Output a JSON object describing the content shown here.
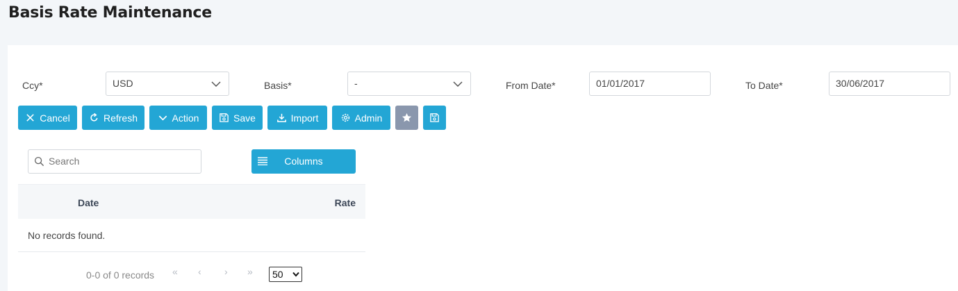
{
  "page": {
    "title": "Basis Rate Maintenance"
  },
  "filters": {
    "ccy_label": "Ccy*",
    "ccy_value": "USD",
    "basis_label": "Basis*",
    "basis_value": "-",
    "from_label": "From Date*",
    "from_value": "01/01/2017",
    "to_label": "To Date*",
    "to_value": "30/06/2017"
  },
  "toolbar": {
    "cancel": "Cancel",
    "refresh": "Refresh",
    "action": "Action",
    "save": "Save",
    "import": "Import",
    "admin": "Admin"
  },
  "grid": {
    "search_placeholder": "Search",
    "columns_label": "Columns",
    "headers": [
      "Date",
      "Rate"
    ],
    "empty_message": "No records found.",
    "pager_info": "0-0 of 0 records",
    "pager_first": "«",
    "pager_prev": "‹",
    "pager_next": "›",
    "pager_last": "»",
    "page_size": "50"
  },
  "colors": {
    "accent": "#23a6d5",
    "secondary": "#8a97ad",
    "background": "#f3f6f9"
  }
}
